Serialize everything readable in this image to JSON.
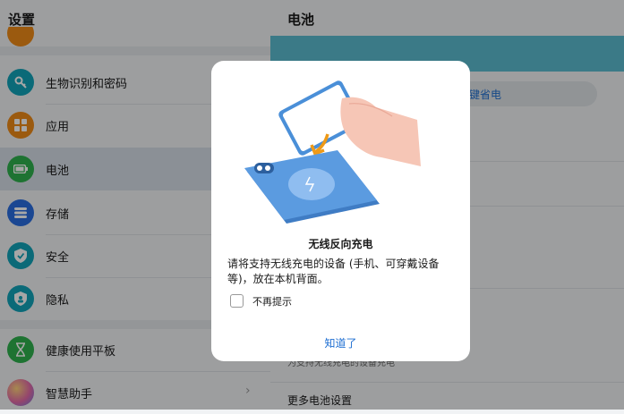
{
  "left_pane": {
    "title": "设置",
    "items": [
      {
        "label": "生物识别和密码",
        "icon": "key-icon",
        "color": "#12a3b8"
      },
      {
        "label": "应用",
        "icon": "apps-grid-icon",
        "color": "#ef8a17"
      },
      {
        "label": "电池",
        "icon": "battery-icon",
        "color": "#2fb14e"
      },
      {
        "label": "存储",
        "icon": "storage-list-icon",
        "color": "#2a6de0"
      },
      {
        "label": "安全",
        "icon": "shield-check-icon",
        "color": "#12a3b8"
      },
      {
        "label": "隐私",
        "icon": "privacy-shield-icon",
        "color": "#12a3b8"
      },
      {
        "label": "健康使用平板",
        "icon": "hourglass-icon",
        "color": "#2fb14e"
      },
      {
        "label": "智慧助手",
        "icon": "assistant-orb-icon",
        "color": "#c46ad8"
      }
    ]
  },
  "right_pane": {
    "title": "电池",
    "one_click_save_partial": "键省电",
    "wireless_desc_partial": "为支持无线充电的设备充电",
    "more_settings": "更多电池设置"
  },
  "dialog": {
    "title": "无线反向充电",
    "body": "请将支持无线充电的设备 (手机、可穿戴设备等)，放在本机背面。",
    "checkbox_label": "不再提示",
    "confirm": "知道了"
  },
  "colors": {
    "accent": "#1f6fd2",
    "teal_banner": "#5bbcd0",
    "tablet_blue": "#4a8fd8"
  }
}
